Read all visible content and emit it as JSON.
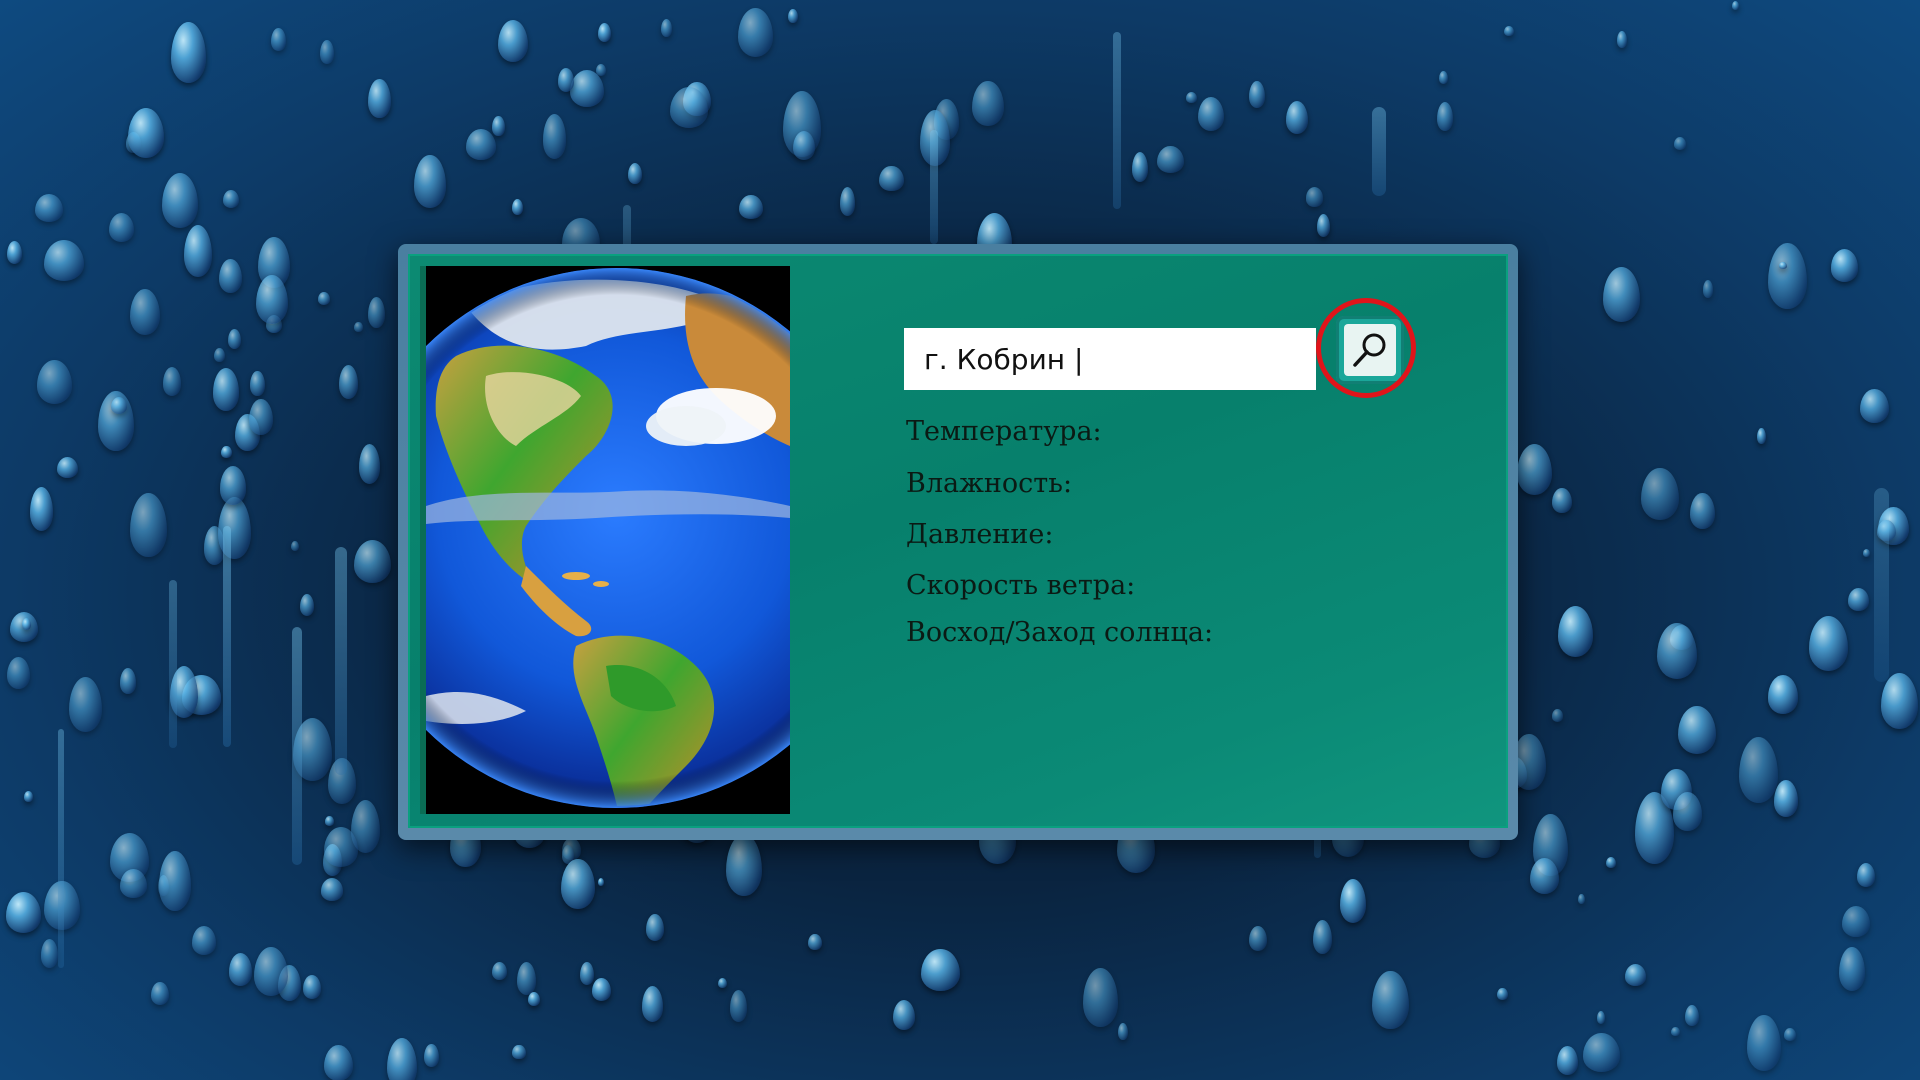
{
  "background": {
    "theme": "rain-drops-on-glass",
    "colors": {
      "dark": "#0a2440",
      "light": "#6fc6f0"
    }
  },
  "widget": {
    "accent_color": "#07806c",
    "image": {
      "icon": "earth-globe-icon",
      "subject": "Earth globe showing the Americas"
    },
    "search": {
      "value": "г. Кобрин |",
      "button_icon": "magnifier-icon",
      "highlight_color": "#e0141a"
    },
    "fields": [
      {
        "label": "Температура:"
      },
      {
        "label": "Влажность:"
      },
      {
        "label": "Давление:"
      },
      {
        "label": "Скорость ветра:"
      },
      {
        "label": "Восход/Заход солнца:"
      }
    ]
  }
}
